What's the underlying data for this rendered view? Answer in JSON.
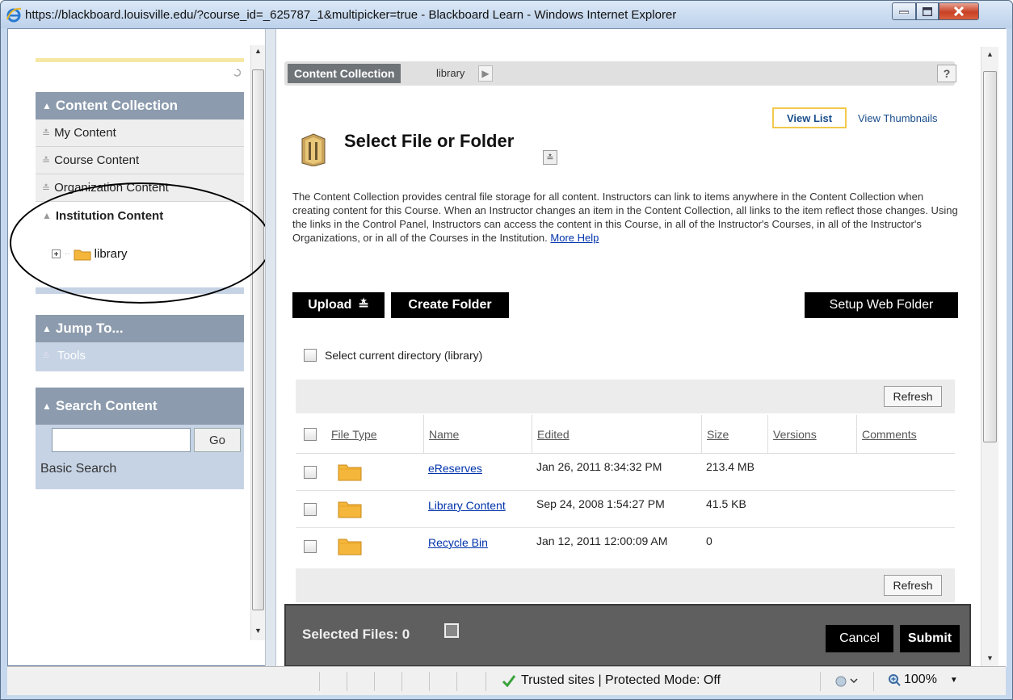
{
  "window": {
    "title": "https://blackboard.louisville.edu/?course_id=_625787_1&multipicker=true - Blackboard Learn - Windows Internet Explorer"
  },
  "sidebar": {
    "content_collection": {
      "header": "Content Collection",
      "items": [
        {
          "label": "My Content"
        },
        {
          "label": "Course Content"
        },
        {
          "label": "Organization Content"
        },
        {
          "label": "Institution Content"
        }
      ],
      "tree_item": "library"
    },
    "jump_to": {
      "header": "Jump To...",
      "item": "Tools"
    },
    "search": {
      "header": "Search Content",
      "input_value": "",
      "go_label": "Go",
      "basic_search": "Basic Search"
    }
  },
  "breadcrumb": {
    "root": "Content Collection",
    "current": "library",
    "help": "?"
  },
  "view": {
    "list": "View List",
    "thumbnails": "View Thumbnails"
  },
  "page": {
    "title": "Select File or Folder",
    "description": "The Content Collection provides central file storage for all content. Instructors can link to items anywhere in the Content Collection when creating content for this Course. When an Instructor changes an item in the Content Collection, all links to the item reflect those changes. Using the links in the Control Panel, Instructors can access the content in this Course, in all of the Instructor's Courses, in all of the Instructor's Organizations, or in all of the Courses in the Institution.",
    "more_help": "More Help"
  },
  "actions": {
    "upload": "Upload",
    "create_folder": "Create Folder",
    "setup_web_folder": "Setup Web Folder"
  },
  "select_current": "Select current directory (library)",
  "refresh": "Refresh",
  "table": {
    "columns": [
      "File Type",
      "Name",
      "Edited",
      "Size",
      "Versions",
      "Comments"
    ],
    "rows": [
      {
        "name": "eReserves",
        "edited": "Jan 26, 2011 8:34:32 PM",
        "size": "213.4 MB"
      },
      {
        "name": "Library Content",
        "edited": "Sep 24, 2008 1:54:27 PM",
        "size": "41.5 KB"
      },
      {
        "name": "Recycle Bin",
        "edited": "Jan 12, 2011 12:00:09 AM",
        "size": "0"
      }
    ]
  },
  "footer": {
    "selected_files": "Selected Files:",
    "count": "0",
    "cancel": "Cancel",
    "submit": "Submit"
  },
  "statusbar": {
    "zone": "Trusted sites | Protected Mode: Off",
    "zoom": "100%"
  }
}
